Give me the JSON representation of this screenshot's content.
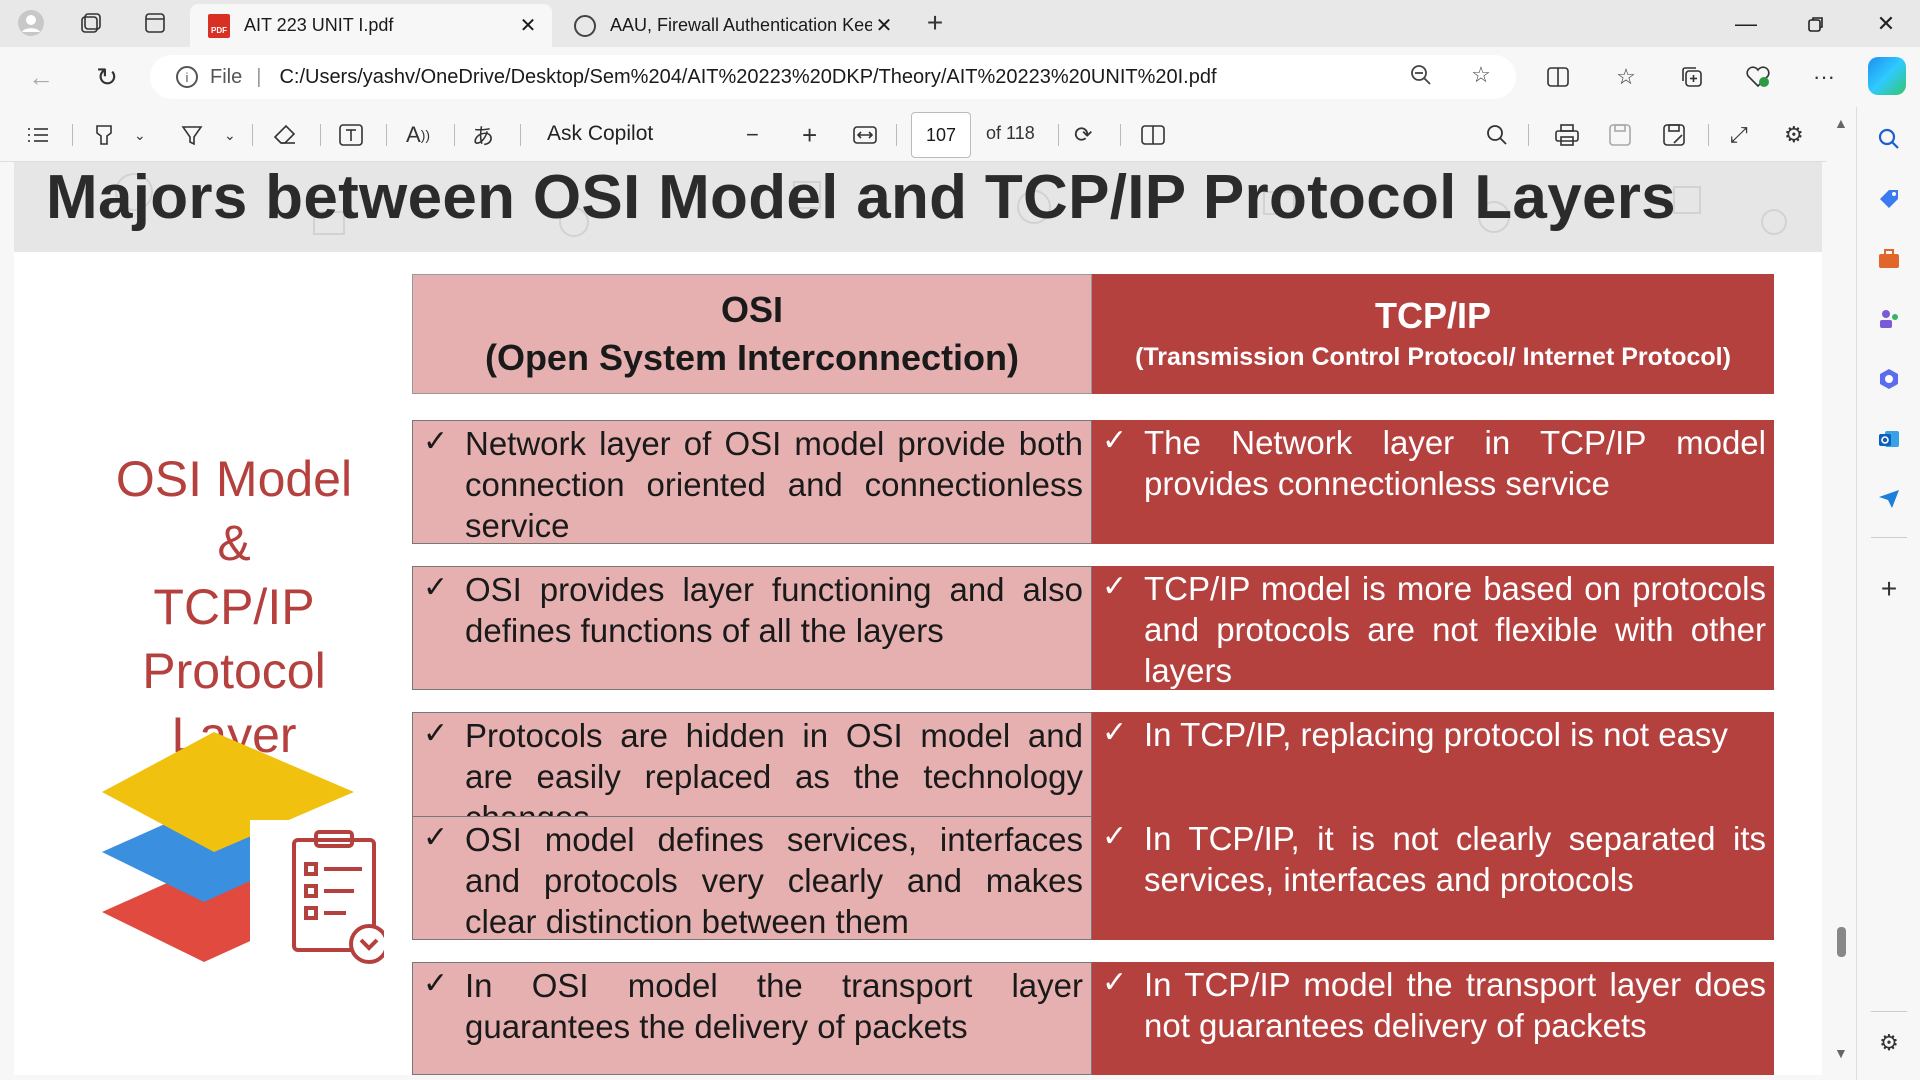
{
  "browser": {
    "tabs": [
      {
        "title": "AIT 223 UNIT I.pdf",
        "icon": "pdf-icon",
        "active": true
      },
      {
        "title": "AAU, Firewall Authentication Kee",
        "icon": "globe-icon",
        "active": false
      }
    ],
    "address": {
      "prefix": "File",
      "url": "C:/Users/yashv/OneDrive/Desktop/Sem%204/AIT%20223%20DKP/Theory/AIT%20223%20UNIT%20I.pdf"
    }
  },
  "pdf_toolbar": {
    "ask_copilot": "Ask Copilot",
    "page_current": "107",
    "page_total": "of 118"
  },
  "slide": {
    "title": "Majors between OSI Model and TCP/IP Protocol Layers",
    "side_title_lines": [
      "OSI Model",
      "&",
      "TCP/IP",
      "Protocol",
      "Layer"
    ],
    "colors": {
      "accent": "#b5413f",
      "light": "#e6b0b0"
    },
    "table": {
      "osi_header": {
        "title": "OSI",
        "subtitle": "(Open System Interconnection)"
      },
      "tcp_header": {
        "title": "TCP/IP",
        "subtitle": "(Transmission Control Protocol/ Internet Protocol)"
      },
      "rows": [
        {
          "osi": "Network layer of OSI model provide both connection oriented and connectionless service",
          "tcp": "The Network layer in TCP/IP model provides connectionless service"
        },
        {
          "osi": "OSI provides layer functioning and also defines functions of all the layers",
          "tcp": "TCP/IP model is more based on protocols and protocols are not flexible with other layers"
        },
        {
          "osi": "Protocols are hidden in OSI model and are easily replaced as the technology changes",
          "tcp": "In TCP/IP, replacing protocol is not easy"
        },
        {
          "osi": "OSI model defines services, interfaces and protocols very clearly and makes clear distinction between them",
          "tcp": "In TCP/IP, it is not clearly separated its services, interfaces and protocols"
        },
        {
          "osi": "In OSI model the transport layer guarantees the delivery of packets",
          "tcp": "In TCP/IP model the transport layer does not guarantees delivery of packets"
        }
      ]
    }
  }
}
